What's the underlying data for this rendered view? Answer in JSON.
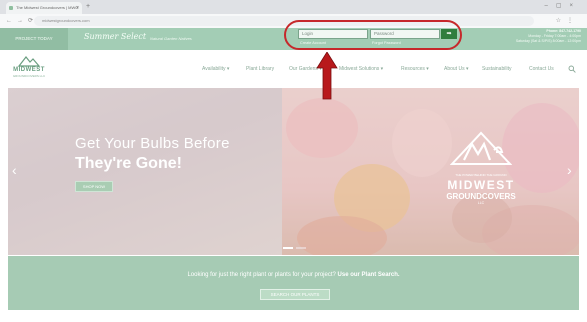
{
  "browser": {
    "tab_title": "The Midwest Groundcovers | MWG",
    "address": "midwestgroundcovers.com"
  },
  "topbar": {
    "left_label": "PROJECT TODAY",
    "script_logo": "Summer Select",
    "tagline": "Natural Garden Natives",
    "login_placeholder": "Login",
    "password_placeholder": "Password",
    "go_label": "➡",
    "create_account": "Create Account",
    "forgot_password": "Forgot Password",
    "contact_line1": "Phone: 847-742-1790",
    "contact_line2": "Monday - Friday 7:00am - 4:00pm",
    "contact_line3": "Saturday (Sat & S/P/S) 8:00am - 12:00pm"
  },
  "header": {
    "logo_word": "MIDWEST",
    "logo_sub": "GROUNDCOVERS LLC",
    "nav": [
      "Availability ▾",
      "Plant Library",
      "Our Gardens ▾",
      "Midwest Solutions ▾",
      "Resources ▾",
      "About Us ▾",
      "Sustainability",
      "Contact Us"
    ]
  },
  "hero": {
    "headline": "Get Your Bulbs Before",
    "headline_bold": "They're Gone!",
    "button_label": "SHOP NOW",
    "prev_arrow": "‹",
    "next_arrow": "›",
    "brand_tag": "THE POWER BEHIND THE GROUND",
    "brand_name": "MIDWEST",
    "brand_sub": "GROUNDCOVERS",
    "brand_llc": "LLC"
  },
  "plant_search": {
    "prompt_text": "Looking for just the right plant or plants for your project?",
    "prompt_bold": "Use our Plant Search.",
    "button_label": "SEARCH OUR PLANTS"
  },
  "colors": {
    "brand_green": "#a3cdb5",
    "go_button": "#2f7d3e",
    "highlight_red": "#c6282b"
  }
}
